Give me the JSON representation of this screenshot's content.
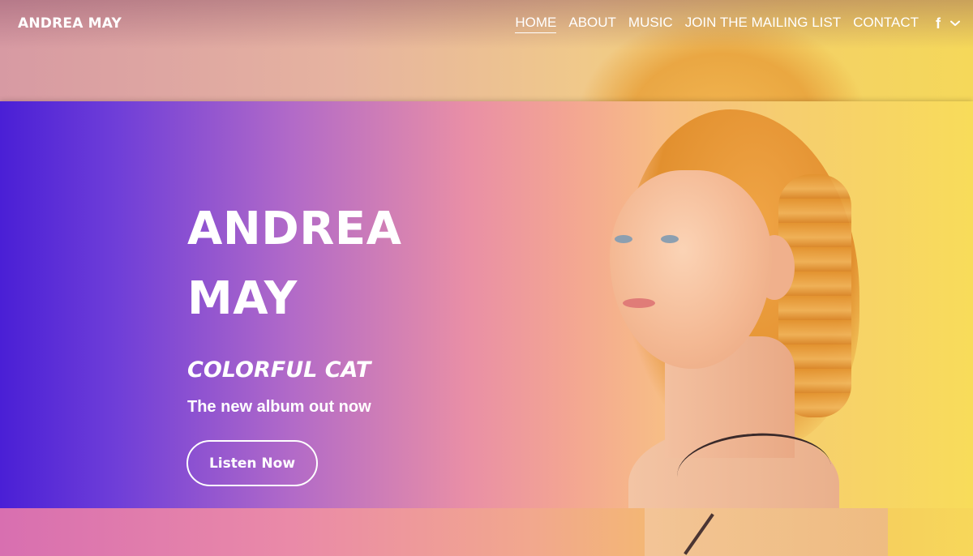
{
  "brand": {
    "name": "ANDREA MAY"
  },
  "nav": {
    "items": [
      {
        "label": "HOME",
        "active": true
      },
      {
        "label": "ABOUT",
        "active": false
      },
      {
        "label": "MUSIC",
        "active": false
      },
      {
        "label": "JOIN THE MAILING LIST",
        "active": false
      },
      {
        "label": "CONTACT",
        "active": false
      }
    ],
    "social_icon": "facebook-icon",
    "more_icon": "chevron-down-icon"
  },
  "hero": {
    "title_line1": "ANDREA",
    "title_line2": "MAY",
    "album": "COLORFUL CAT",
    "tagline": "The new album out now",
    "cta_label": "Listen Now"
  },
  "colors": {
    "gradient_start": "#4a1fd6",
    "gradient_mid": "#e98fa6",
    "gradient_end": "#f8dc5a",
    "text": "#ffffff"
  }
}
